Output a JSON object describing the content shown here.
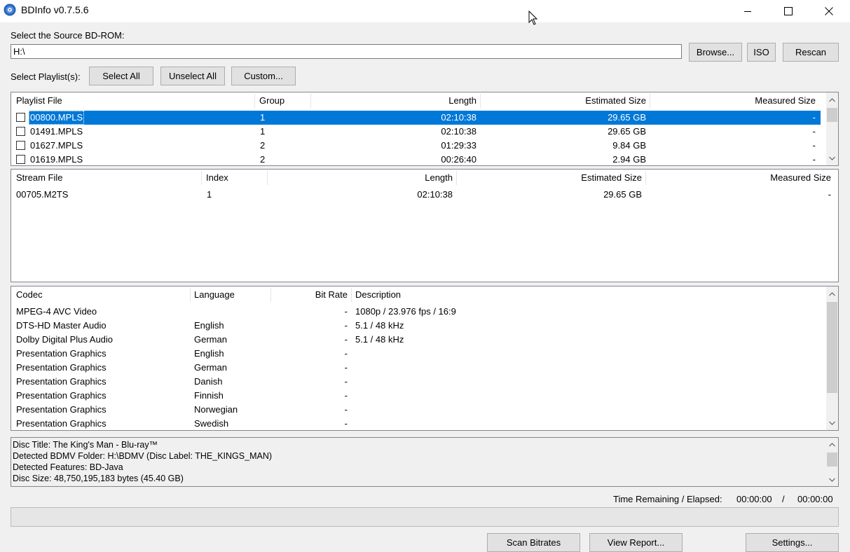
{
  "window": {
    "title": "BDInfo v0.7.5.6"
  },
  "source": {
    "label": "Select the Source BD-ROM:",
    "path": "H:\\",
    "browse": "Browse...",
    "iso": "ISO",
    "rescan": "Rescan"
  },
  "playlist_select": {
    "label": "Select Playlist(s):",
    "select_all": "Select All",
    "unselect_all": "Unselect All",
    "custom": "Custom..."
  },
  "playlists": {
    "columns": [
      "Playlist File",
      "Group",
      "Length",
      "Estimated Size",
      "Measured Size"
    ],
    "rows": [
      {
        "file": "00800.MPLS",
        "group": "1",
        "length": "02:10:38",
        "est": "29.65 GB",
        "measured": "-",
        "selected": true
      },
      {
        "file": "01491.MPLS",
        "group": "1",
        "length": "02:10:38",
        "est": "29.65 GB",
        "measured": "-"
      },
      {
        "file": "01627.MPLS",
        "group": "2",
        "length": "01:29:33",
        "est": "9.84 GB",
        "measured": "-"
      },
      {
        "file": "01619.MPLS",
        "group": "2",
        "length": "00:26:40",
        "est": "2.94 GB",
        "measured": "-"
      }
    ]
  },
  "streams": {
    "columns": [
      "Stream File",
      "Index",
      "Length",
      "Estimated Size",
      "Measured Size"
    ],
    "rows": [
      {
        "file": "00705.M2TS",
        "index": "1",
        "length": "02:10:38",
        "est": "29.65 GB",
        "measured": "-"
      }
    ]
  },
  "codecs": {
    "columns": [
      "Codec",
      "Language",
      "Bit Rate",
      "Description"
    ],
    "rows": [
      {
        "codec": "MPEG-4 AVC Video",
        "lang": "",
        "bitrate": "-",
        "desc": "1080p / 23.976 fps / 16:9"
      },
      {
        "codec": "DTS-HD Master Audio",
        "lang": "English",
        "bitrate": "-",
        "desc": "5.1 / 48 kHz"
      },
      {
        "codec": "Dolby Digital Plus Audio",
        "lang": "German",
        "bitrate": "-",
        "desc": "5.1 / 48 kHz"
      },
      {
        "codec": "Presentation Graphics",
        "lang": "English",
        "bitrate": "-",
        "desc": ""
      },
      {
        "codec": "Presentation Graphics",
        "lang": "German",
        "bitrate": "-",
        "desc": ""
      },
      {
        "codec": "Presentation Graphics",
        "lang": "Danish",
        "bitrate": "-",
        "desc": ""
      },
      {
        "codec": "Presentation Graphics",
        "lang": "Finnish",
        "bitrate": "-",
        "desc": ""
      },
      {
        "codec": "Presentation Graphics",
        "lang": "Norwegian",
        "bitrate": "-",
        "desc": ""
      },
      {
        "codec": "Presentation Graphics",
        "lang": "Swedish",
        "bitrate": "-",
        "desc": ""
      }
    ]
  },
  "disc_info": {
    "lines": [
      "Disc Title: The King's Man - Blu-ray™",
      "Detected BDMV Folder: H:\\BDMV (Disc Label: THE_KINGS_MAN)",
      "Detected Features: BD-Java",
      "Disc Size: 48,750,195,183 bytes (45.40 GB)"
    ]
  },
  "status": {
    "time_label": "Time Remaining / Elapsed:",
    "remaining": "00:00:00",
    "separator": "/",
    "elapsed": "00:00:00",
    "progress": 0
  },
  "footer": {
    "scan_bitrates": "Scan Bitrates",
    "view_report": "View Report...",
    "settings": "Settings..."
  },
  "icons": {
    "app": "disc-icon",
    "minimize": "minimize-icon",
    "maximize": "maximize-icon",
    "close": "close-icon",
    "scroll_up": "chevron-up-icon",
    "scroll_down": "chevron-down-icon"
  },
  "colors": {
    "selection": "#0078d7",
    "window_bg": "#f0f0f0"
  }
}
